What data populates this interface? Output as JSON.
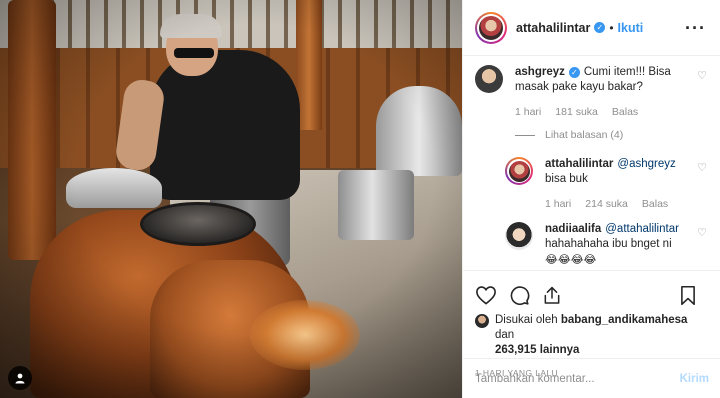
{
  "post": {
    "author": "attahalilintar",
    "follow_label": "Ikuti",
    "separator": "•",
    "more_label": "···"
  },
  "photo": {
    "tag_icon": "person-icon"
  },
  "comments": [
    {
      "user": "ashgreyz",
      "verified": true,
      "text": "Cumi item!!! Bisa masak pake kayu bakar?",
      "time": "1 hari",
      "likes": "181 suka",
      "reply_label": "Balas",
      "view_replies": "Lihat balasan (4)"
    },
    {
      "user": "attahalilintar",
      "mention": "@ashgreyz",
      "text": "bisa buk",
      "time": "1 hari",
      "likes": "214 suka",
      "reply_label": "Balas"
    },
    {
      "user": "nadiiaalifa",
      "mention": "@attahalilintar",
      "text": "hahahahaha ibu bnget ni",
      "emoji": "😂😂😂😂"
    }
  ],
  "actions": {
    "like_icon": "heart-icon",
    "comment_icon": "comment-icon",
    "share_icon": "share-icon",
    "save_icon": "bookmark-icon"
  },
  "likes": {
    "prefix": "Disukai oleh",
    "user": "babang_andikamahesa",
    "and": "dan",
    "count": "263,915",
    "suffix": "lainnya"
  },
  "timestamp": "1 hari yang lalu",
  "add_comment": {
    "placeholder": "Tambahkan komentar...",
    "post_label": "Kirim"
  },
  "colors": {
    "accent": "#3897f0",
    "text": "#262626",
    "muted": "#8e8e8e",
    "post_disabled": "#b3dbff"
  }
}
